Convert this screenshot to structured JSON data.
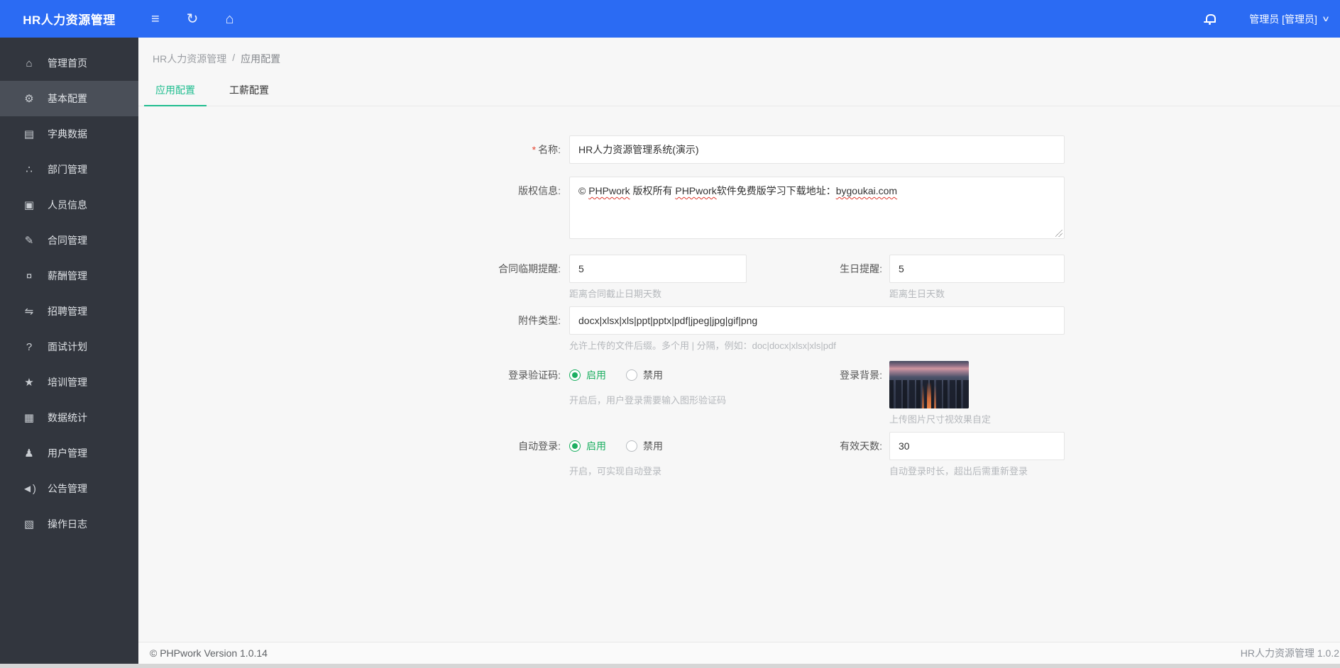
{
  "colors": {
    "topbar_blue": "#2b6bf3",
    "sidebar_bg": "#32363e",
    "sidebar_active_bg": "#4a4f58",
    "tab_accent_green": "#1fbd8f",
    "radio_green": "#1caf61",
    "required_red": "#e5432e",
    "spellcheck_wave_red": "#e03a2f"
  },
  "topbar": {
    "logo": "HR人力资源管理",
    "collapse_icon": "≡",
    "refresh_icon": "↻",
    "home_icon": "⌂",
    "user": "管理员 [管理员]",
    "caret_icon": "∨"
  },
  "sidebar": {
    "items": [
      {
        "icon": "home-icon",
        "glyph": "⌂",
        "label": "管理首页",
        "active": false
      },
      {
        "icon": "gear-icon",
        "glyph": "⚙",
        "label": "基本配置",
        "active": true
      },
      {
        "icon": "book-icon",
        "glyph": "▤",
        "label": "字典数据",
        "active": false
      },
      {
        "icon": "sitemap-icon",
        "glyph": "∴",
        "label": "部门管理",
        "active": false
      },
      {
        "icon": "idcard-icon",
        "glyph": "▣",
        "label": "人员信息",
        "active": false
      },
      {
        "icon": "pen-icon",
        "glyph": "✎",
        "label": "合同管理",
        "active": false
      },
      {
        "icon": "money-icon",
        "glyph": "¤",
        "label": "薪酬管理",
        "active": false
      },
      {
        "icon": "handshake-icon",
        "glyph": "⇋",
        "label": "招聘管理",
        "active": false
      },
      {
        "icon": "question-icon",
        "glyph": "?",
        "label": "面试计划",
        "active": false
      },
      {
        "icon": "graduation-cap-icon",
        "glyph": "★",
        "label": "培训管理",
        "active": false
      },
      {
        "icon": "bar-chart-icon",
        "glyph": "▦",
        "label": "数据统计",
        "active": false
      },
      {
        "icon": "user-icon",
        "glyph": "♟",
        "label": "用户管理",
        "active": false
      },
      {
        "icon": "speaker-icon",
        "glyph": "◄)",
        "label": "公告管理",
        "active": false
      },
      {
        "icon": "log-icon",
        "glyph": "▧",
        "label": "操作日志",
        "active": false
      }
    ]
  },
  "breadcrumb": {
    "root": "HR人力资源管理",
    "separator": "/",
    "current": "应用配置"
  },
  "tabs": {
    "app_config": "应用配置",
    "salary_config": "工薪配置"
  },
  "form": {
    "name": {
      "required_mark": "*",
      "label": "名称:",
      "value": "HR人力资源管理系统(演示)"
    },
    "copyright": {
      "label": "版权信息:",
      "seg1": "© ",
      "seg2": "PHPwork",
      "seg3": " 版权所有 ",
      "seg4": "PHPwork",
      "seg5": "软件免费版学习下载地址：",
      "seg6": "bygoukai.com"
    },
    "contract_remind": {
      "label": "合同临期提醒:",
      "value": "5",
      "hint": "距离合同截止日期天数"
    },
    "birthday_remind": {
      "label": "生日提醒:",
      "value": "5",
      "hint": "距离生日天数"
    },
    "attachment": {
      "label": "附件类型:",
      "value": "docx|xlsx|xls|ppt|pptx|pdf|jpeg|jpg|gif|png",
      "hint": "允许上传的文件后缀。多个用 | 分隔，例如：doc|docx|xlsx|xls|pdf"
    },
    "captcha": {
      "label": "登录验证码:",
      "on_label": "启用",
      "off_label": "禁用",
      "hint": "开启后，用户登录需要输入图形验证码"
    },
    "login_bg": {
      "label": "登录背景:",
      "hint": "上传图片尺寸视效果自定"
    },
    "auto_login": {
      "label": "自动登录:",
      "on_label": "启用",
      "off_label": "禁用",
      "hint": "开启，可实现自动登录"
    },
    "valid_days": {
      "label": "有效天数:",
      "value": "30",
      "hint": "自动登录时长，超出后需重新登录"
    }
  },
  "footer": {
    "left": "© PHPwork Version 1.0.14",
    "right": "HR人力资源管理 1.0.2"
  }
}
